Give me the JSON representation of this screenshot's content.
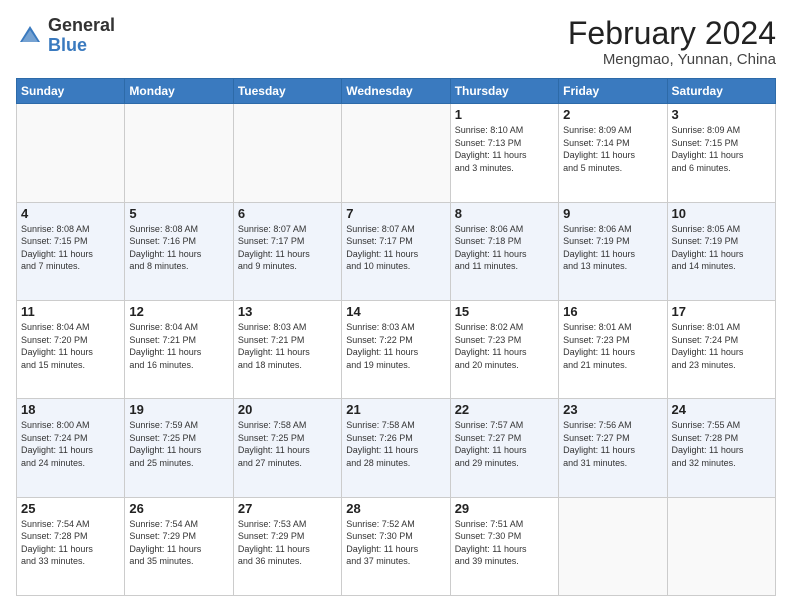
{
  "header": {
    "logo_general": "General",
    "logo_blue": "Blue",
    "main_title": "February 2024",
    "sub_title": "Mengmao, Yunnan, China"
  },
  "days_of_week": [
    "Sunday",
    "Monday",
    "Tuesday",
    "Wednesday",
    "Thursday",
    "Friday",
    "Saturday"
  ],
  "weeks": [
    [
      {
        "day": "",
        "info": ""
      },
      {
        "day": "",
        "info": ""
      },
      {
        "day": "",
        "info": ""
      },
      {
        "day": "",
        "info": ""
      },
      {
        "day": "1",
        "info": "Sunrise: 8:10 AM\nSunset: 7:13 PM\nDaylight: 11 hours\nand 3 minutes."
      },
      {
        "day": "2",
        "info": "Sunrise: 8:09 AM\nSunset: 7:14 PM\nDaylight: 11 hours\nand 5 minutes."
      },
      {
        "day": "3",
        "info": "Sunrise: 8:09 AM\nSunset: 7:15 PM\nDaylight: 11 hours\nand 6 minutes."
      }
    ],
    [
      {
        "day": "4",
        "info": "Sunrise: 8:08 AM\nSunset: 7:15 PM\nDaylight: 11 hours\nand 7 minutes."
      },
      {
        "day": "5",
        "info": "Sunrise: 8:08 AM\nSunset: 7:16 PM\nDaylight: 11 hours\nand 8 minutes."
      },
      {
        "day": "6",
        "info": "Sunrise: 8:07 AM\nSunset: 7:17 PM\nDaylight: 11 hours\nand 9 minutes."
      },
      {
        "day": "7",
        "info": "Sunrise: 8:07 AM\nSunset: 7:17 PM\nDaylight: 11 hours\nand 10 minutes."
      },
      {
        "day": "8",
        "info": "Sunrise: 8:06 AM\nSunset: 7:18 PM\nDaylight: 11 hours\nand 11 minutes."
      },
      {
        "day": "9",
        "info": "Sunrise: 8:06 AM\nSunset: 7:19 PM\nDaylight: 11 hours\nand 13 minutes."
      },
      {
        "day": "10",
        "info": "Sunrise: 8:05 AM\nSunset: 7:19 PM\nDaylight: 11 hours\nand 14 minutes."
      }
    ],
    [
      {
        "day": "11",
        "info": "Sunrise: 8:04 AM\nSunset: 7:20 PM\nDaylight: 11 hours\nand 15 minutes."
      },
      {
        "day": "12",
        "info": "Sunrise: 8:04 AM\nSunset: 7:21 PM\nDaylight: 11 hours\nand 16 minutes."
      },
      {
        "day": "13",
        "info": "Sunrise: 8:03 AM\nSunset: 7:21 PM\nDaylight: 11 hours\nand 18 minutes."
      },
      {
        "day": "14",
        "info": "Sunrise: 8:03 AM\nSunset: 7:22 PM\nDaylight: 11 hours\nand 19 minutes."
      },
      {
        "day": "15",
        "info": "Sunrise: 8:02 AM\nSunset: 7:23 PM\nDaylight: 11 hours\nand 20 minutes."
      },
      {
        "day": "16",
        "info": "Sunrise: 8:01 AM\nSunset: 7:23 PM\nDaylight: 11 hours\nand 21 minutes."
      },
      {
        "day": "17",
        "info": "Sunrise: 8:01 AM\nSunset: 7:24 PM\nDaylight: 11 hours\nand 23 minutes."
      }
    ],
    [
      {
        "day": "18",
        "info": "Sunrise: 8:00 AM\nSunset: 7:24 PM\nDaylight: 11 hours\nand 24 minutes."
      },
      {
        "day": "19",
        "info": "Sunrise: 7:59 AM\nSunset: 7:25 PM\nDaylight: 11 hours\nand 25 minutes."
      },
      {
        "day": "20",
        "info": "Sunrise: 7:58 AM\nSunset: 7:25 PM\nDaylight: 11 hours\nand 27 minutes."
      },
      {
        "day": "21",
        "info": "Sunrise: 7:58 AM\nSunset: 7:26 PM\nDaylight: 11 hours\nand 28 minutes."
      },
      {
        "day": "22",
        "info": "Sunrise: 7:57 AM\nSunset: 7:27 PM\nDaylight: 11 hours\nand 29 minutes."
      },
      {
        "day": "23",
        "info": "Sunrise: 7:56 AM\nSunset: 7:27 PM\nDaylight: 11 hours\nand 31 minutes."
      },
      {
        "day": "24",
        "info": "Sunrise: 7:55 AM\nSunset: 7:28 PM\nDaylight: 11 hours\nand 32 minutes."
      }
    ],
    [
      {
        "day": "25",
        "info": "Sunrise: 7:54 AM\nSunset: 7:28 PM\nDaylight: 11 hours\nand 33 minutes."
      },
      {
        "day": "26",
        "info": "Sunrise: 7:54 AM\nSunset: 7:29 PM\nDaylight: 11 hours\nand 35 minutes."
      },
      {
        "day": "27",
        "info": "Sunrise: 7:53 AM\nSunset: 7:29 PM\nDaylight: 11 hours\nand 36 minutes."
      },
      {
        "day": "28",
        "info": "Sunrise: 7:52 AM\nSunset: 7:30 PM\nDaylight: 11 hours\nand 37 minutes."
      },
      {
        "day": "29",
        "info": "Sunrise: 7:51 AM\nSunset: 7:30 PM\nDaylight: 11 hours\nand 39 minutes."
      },
      {
        "day": "",
        "info": ""
      },
      {
        "day": "",
        "info": ""
      }
    ]
  ]
}
